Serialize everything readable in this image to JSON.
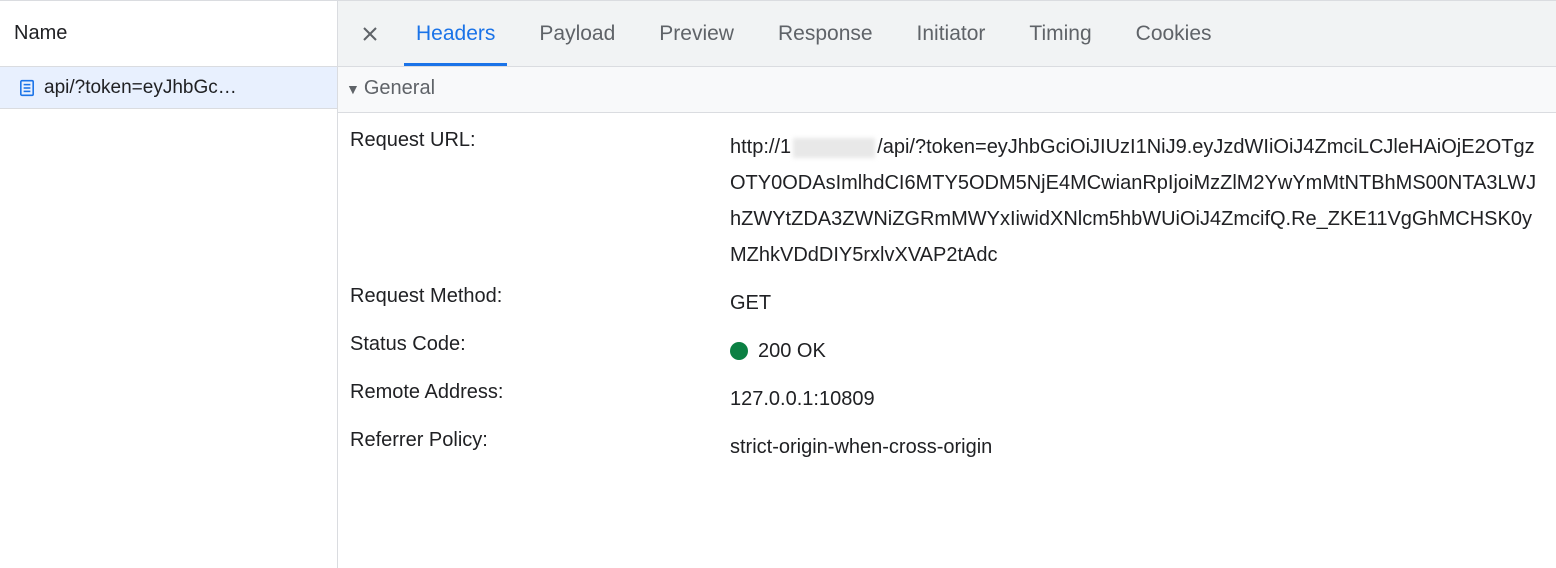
{
  "left": {
    "header": "Name",
    "requests": [
      {
        "name": "api/?token=eyJhbGc…"
      }
    ]
  },
  "tabs": [
    {
      "label": "Headers",
      "active": true
    },
    {
      "label": "Payload",
      "active": false
    },
    {
      "label": "Preview",
      "active": false
    },
    {
      "label": "Response",
      "active": false
    },
    {
      "label": "Initiator",
      "active": false
    },
    {
      "label": "Timing",
      "active": false
    },
    {
      "label": "Cookies",
      "active": false
    }
  ],
  "general": {
    "title": "General",
    "request_url_label": "Request URL:",
    "request_url_prefix": "http://1",
    "request_url_suffix": "/api/?token=eyJhbGciOiJIUzI1NiJ9.eyJzdWIiOiJ4ZmciLCJleHAiOjE2OTgzOTY0ODAsImlhdCI6MTY5ODM5NjE4MCwianRpIjoiMzZlM2YwYmMtNTBhMS00NTA3LWJhZWYtZDA3ZWNiZGRmMWYxIiwidXNlcm5hbWUiOiJ4ZmcifQ.Re_ZKE11VgGhMCHSK0yMZhkVDdDIY5rxlvXVAP2tAdc",
    "request_method_label": "Request Method:",
    "request_method": "GET",
    "status_code_label": "Status Code:",
    "status_code": "200 OK",
    "status_color": "#0b8043",
    "remote_address_label": "Remote Address:",
    "remote_address": "127.0.0.1:10809",
    "referrer_policy_label": "Referrer Policy:",
    "referrer_policy": "strict-origin-when-cross-origin"
  }
}
